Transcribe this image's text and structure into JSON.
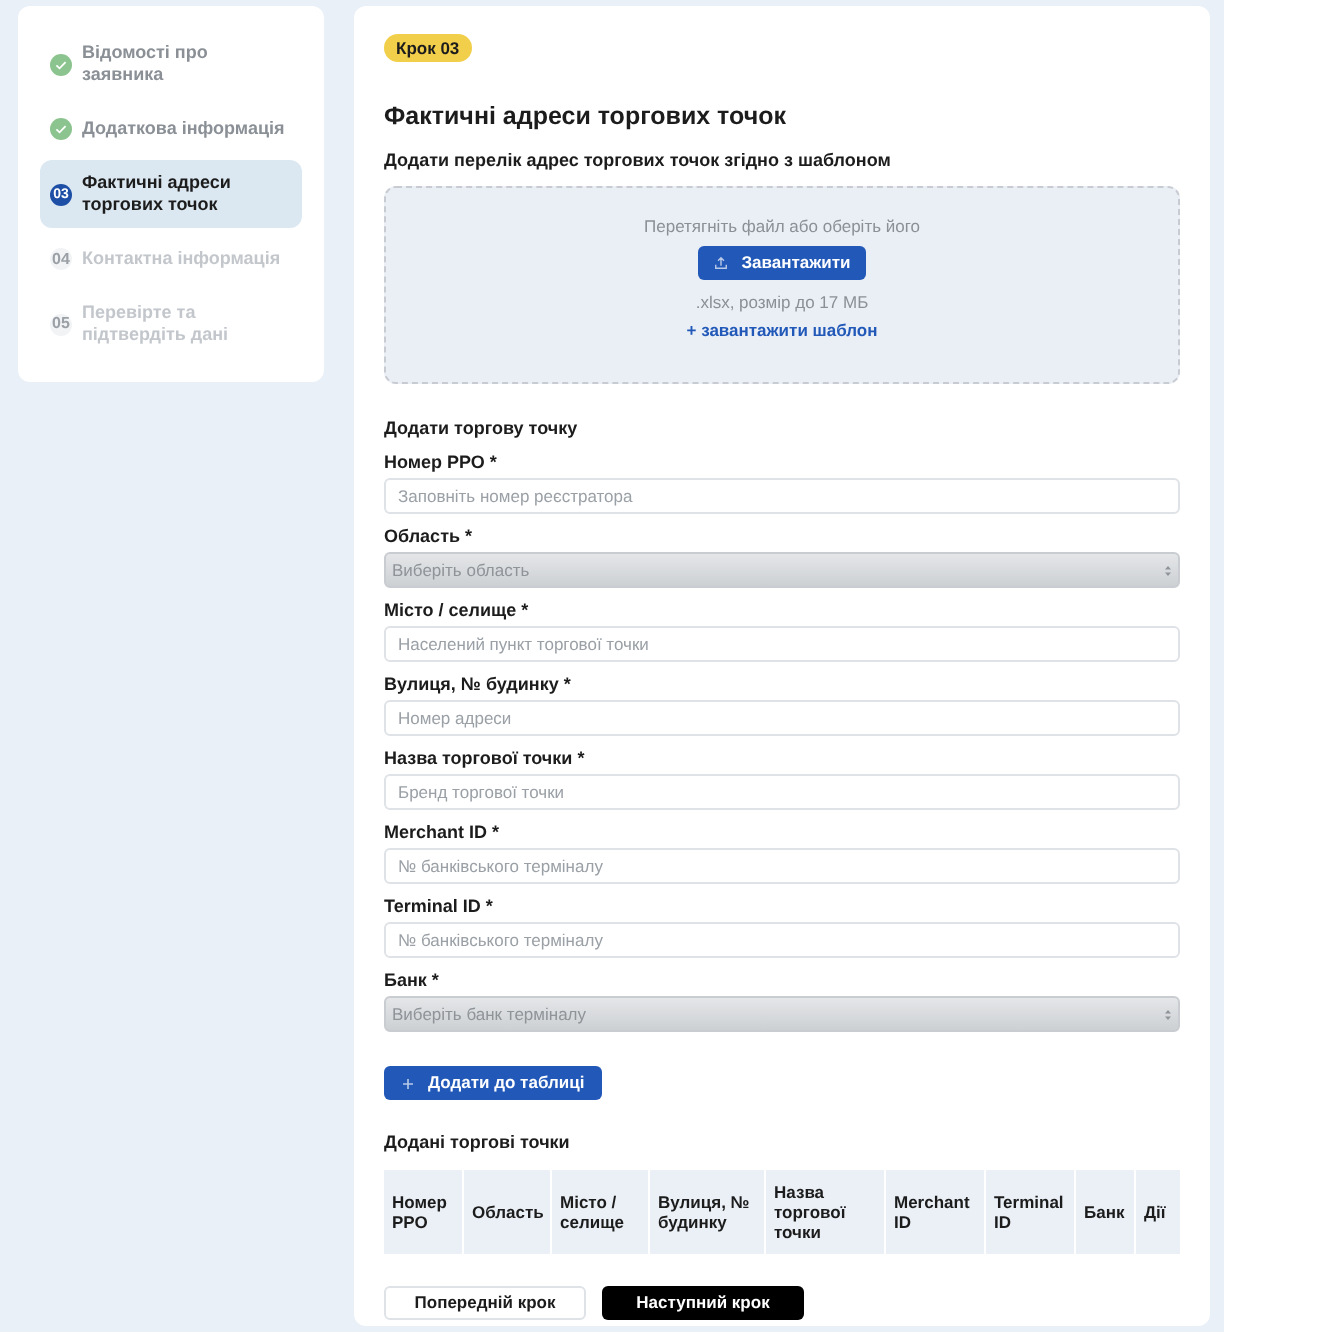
{
  "steps": [
    {
      "kind": "done",
      "label": "Відомості про заявника",
      "selected": false
    },
    {
      "kind": "done",
      "label": "Додаткова інформація",
      "selected": false
    },
    {
      "kind": "current",
      "number": "03",
      "label": "Фактичні адреси торгових точок",
      "selected": true
    },
    {
      "kind": "todo",
      "number": "04",
      "label": "Контактна інформація",
      "selected": false
    },
    {
      "kind": "todo",
      "number": "05",
      "label": "Перевірте та підтвердіть дані",
      "selected": false
    }
  ],
  "main": {
    "badge": "Крок 03",
    "title": "Фактичні адреси торгових точок",
    "upload": {
      "heading": "Додати перелік адрес торгових точок згідно з шаблоном",
      "hint": "Перетягніть файл або оберіть його",
      "button": "Завантажити",
      "note": ".xlsx, розмір до 17 МБ",
      "template_link": "+ завантажити шаблон"
    },
    "form": {
      "heading": "Додати торгову точку",
      "fields": [
        {
          "kind": "input",
          "label": "Номер РРО *",
          "placeholder": "Заповніть номер реєстратора"
        },
        {
          "kind": "select",
          "label": "Область *",
          "placeholder": "Виберіть область"
        },
        {
          "kind": "input",
          "label": "Місто / селище *",
          "placeholder": "Населений пункт торгової точки"
        },
        {
          "kind": "input",
          "label": "Вулиця, № будинку *",
          "placeholder": "Номер адреси"
        },
        {
          "kind": "input",
          "label": "Назва торгової точки *",
          "placeholder": "Бренд торгової точки"
        },
        {
          "kind": "input",
          "label": "Merchant ID *",
          "placeholder": "№ банківського терміналу"
        },
        {
          "kind": "input",
          "label": "Terminal ID *",
          "placeholder": "№ банківського терміналу"
        },
        {
          "kind": "select",
          "label": "Банк *",
          "placeholder": "Виберіть банк терміналу"
        }
      ],
      "add_button": "Додати до таблиці"
    },
    "table": {
      "heading": "Додані торгові точки",
      "columns": [
        "Номер РРО",
        "Область",
        "Місто / селище",
        "Вулиця, № будинку",
        "Назва торгової точки",
        "Merchant ID",
        "Terminal ID",
        "Банк",
        "Дії"
      ]
    },
    "buttons": [
      {
        "kind": "secondary",
        "label": "Попередній крок"
      },
      {
        "kind": "primary",
        "label": "Наступний крок"
      }
    ]
  }
}
